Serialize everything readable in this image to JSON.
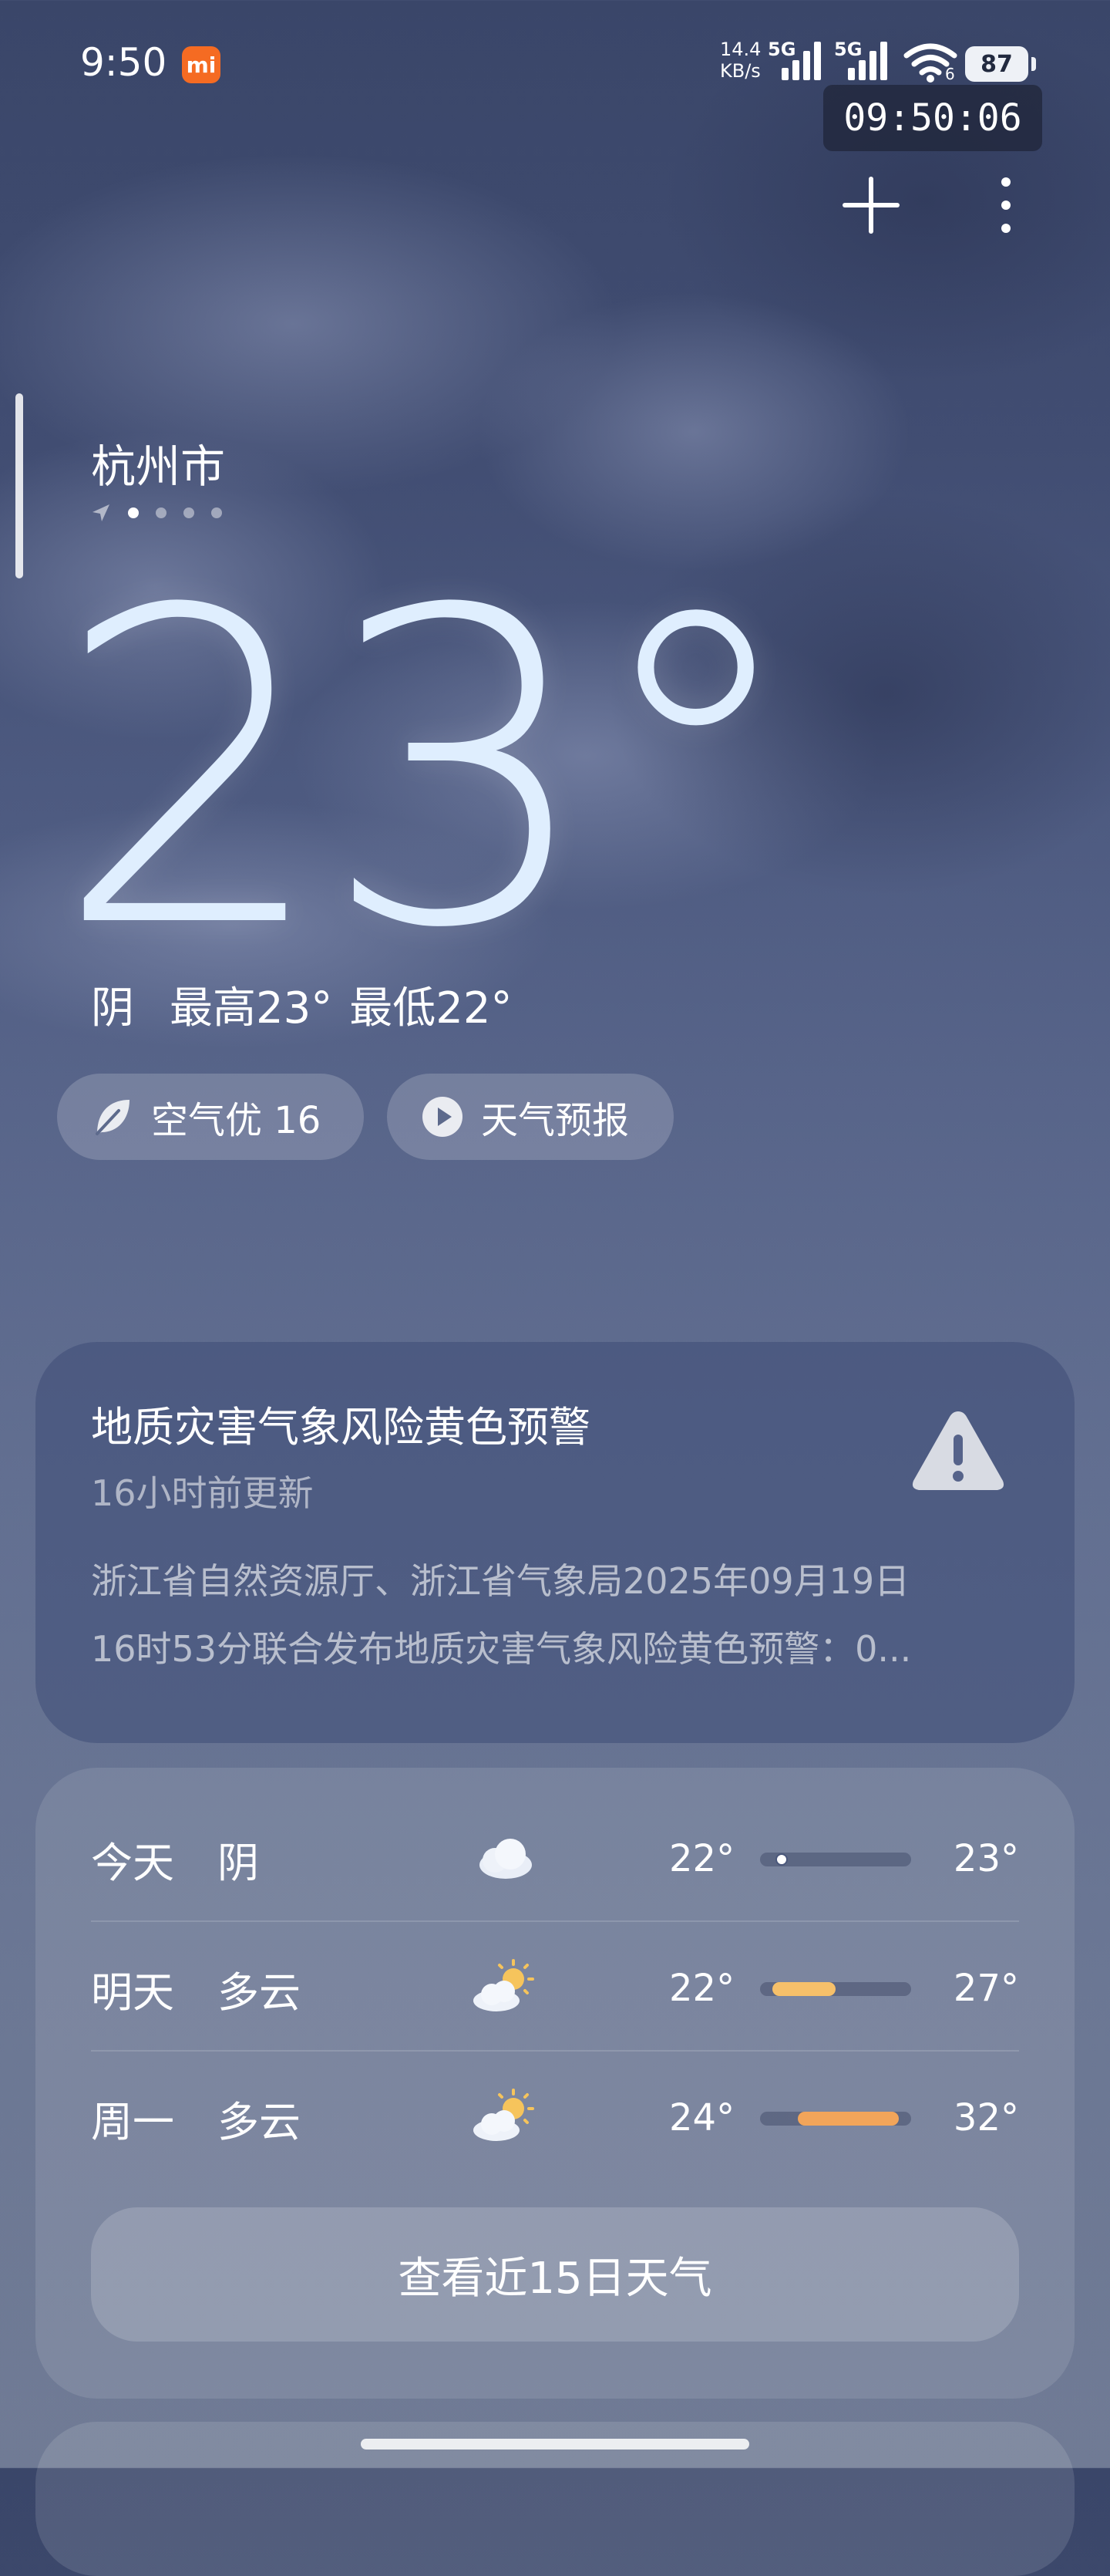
{
  "status_bar": {
    "time": "9:50",
    "mi_badge": "mi",
    "speed_value": "14.4",
    "speed_unit": "KB/s",
    "net1": "5G",
    "net2": "5G",
    "wifi_badge": "6",
    "battery": "87"
  },
  "clock_overlay": "09:50:06",
  "location": {
    "city": "杭州市",
    "page_count": 4,
    "active_page": 1
  },
  "current": {
    "temperature": "23°",
    "condition": "阴",
    "high": "最高23°",
    "low": "最低22°"
  },
  "chips": {
    "air": "空气优 16",
    "forecast": "天气预报"
  },
  "warning": {
    "title": "地质灾害气象风险黄色预警",
    "updated": "16小时前更新",
    "line1": "浙江省自然资源厅、浙江省气象局2025年09月19日",
    "line2": "16时53分联合发布地质灾害气象风险黄色预警：0..."
  },
  "forecast": [
    {
      "day": "今天",
      "condition": "阴",
      "icon": "cloudy-icon",
      "low": "22°",
      "high": "23°",
      "range": [
        22,
        23
      ]
    },
    {
      "day": "明天",
      "condition": "多云",
      "icon": "partly-cloudy-icon",
      "low": "22°",
      "high": "27°",
      "range": [
        22,
        27
      ]
    },
    {
      "day": "周一",
      "condition": "多云",
      "icon": "partly-cloudy-icon",
      "low": "24°",
      "high": "32°",
      "range": [
        24,
        32
      ]
    }
  ],
  "more_button": "查看近15日天气",
  "colors": {
    "bar_warm": "#f6c06a",
    "bar_hot": "#f2a55a",
    "bar_track": "#4a577b"
  }
}
